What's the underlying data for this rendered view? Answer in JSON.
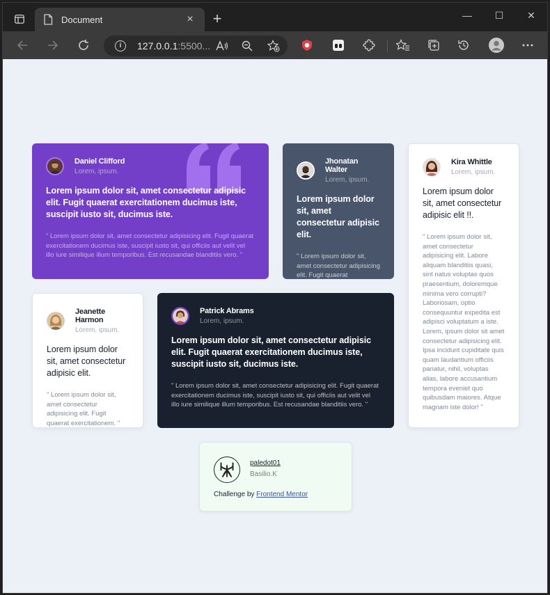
{
  "browser": {
    "tab_title": "Document",
    "url_host": "127.0.0.1",
    "url_rest": ":5500...",
    "close_glyph": "×",
    "newtab_glyph": "+"
  },
  "window_controls": {
    "minimize": "—",
    "maximize": "☐",
    "close": "✕"
  },
  "toolbar_icons": [
    "back-icon",
    "forward-icon",
    "refresh-icon",
    "read-aloud-icon",
    "zoom-icon",
    "add-favorite-icon",
    "shield-extension-icon",
    "extension-icon",
    "puzzle-icon",
    "favorites-icon",
    "collections-icon",
    "history-icon",
    "profile-icon",
    "more-icon"
  ],
  "cards": [
    {
      "name": "Daniel Clifford",
      "verified": "Lorem, ipsum.",
      "headline": "Lorem ipsum dolor sit, amet consectetur adipisic elit. Fugit quaerat exercitationem ducimus iste, suscipit iusto sit, ducimus iste.",
      "quote": "\" Lorem ipsum dolor sit, amet consectetur adipisicing elit. Fugit quaerat exercitationem ducimus iste, suscipit iusto sit, qui officiis aut velit vel illo iure similique illum temporibus. Est recusandae blanditiis vero. \""
    },
    {
      "name": "Jhonatan Walter",
      "verified": "Lorem, ipsum.",
      "headline": "Lorem ipsum dolor sit, amet consectetur adipisic elit.",
      "quote": "\" Lorem ipsum dolor sit, amet consectetur adipisicing elit. Fugit quaerat exercitationem. \""
    },
    {
      "name": "Kira Whittle",
      "verified": "Lorem, ipsum.",
      "headline": "Lorem ipsum dolor sit, amet consectetur adipisic elit !!.",
      "quote": "\" Lorem ipsum dolor sit, amet consectetur adipisicing elit. Labore aliquam blanditiis quasi, sint natus voluptas quos praesentium, doloremque minima vero corrupti? Laboriosam, optio consequuntur expedita est adipisci voluptatum a iste. Lorem, ipsum dolor sit amet consectetur adipisicing elit. Ipsa incidunt cupiditate quis quam laudantium officiis pariatur, nihil, voluptas alias, labore accusantium tempora eveniet quo quibusdam maiores. Atque magnam iste dolor! \""
    },
    {
      "name": "Jeanette Harmon",
      "verified": "Lorem, ipsum.",
      "headline": "Lorem ipsum dolor sit, amet consectetur adipisic elit.",
      "quote": "\" Lorem ipsum dolor sit, amet consectetur adipisicing elit. Fugit quaerat exercitationem. \""
    },
    {
      "name": "Patrick Abrams",
      "verified": "Lorem, ipsum.",
      "headline": "Lorem ipsum dolor sit, amet consectetur adipisic elit. Fugit quaerat exercitationem ducimus iste, suscipit iusto sit, ducimus iste.",
      "quote": "\" Lorem ipsum dolor sit, amet consectetur adipisicing elit. Fugit quaerat exercitationem ducimus iste, suscipit iusto sit, qui officiis aut velit vel illo iure similique illum temporibus. Est recusandae blanditiis vero. \""
    }
  ],
  "attribution": {
    "username": "paledot01",
    "name": "Basilio.K",
    "challenge_prefix": "Challenge by",
    "challenge_link": "Frontend Mentor"
  },
  "colors": {
    "purple": "#733fc8",
    "slate": "#48556a",
    "dark": "#19212e",
    "page_bg": "#ecf1f8",
    "attribution_bg": "#f0fbf4"
  }
}
